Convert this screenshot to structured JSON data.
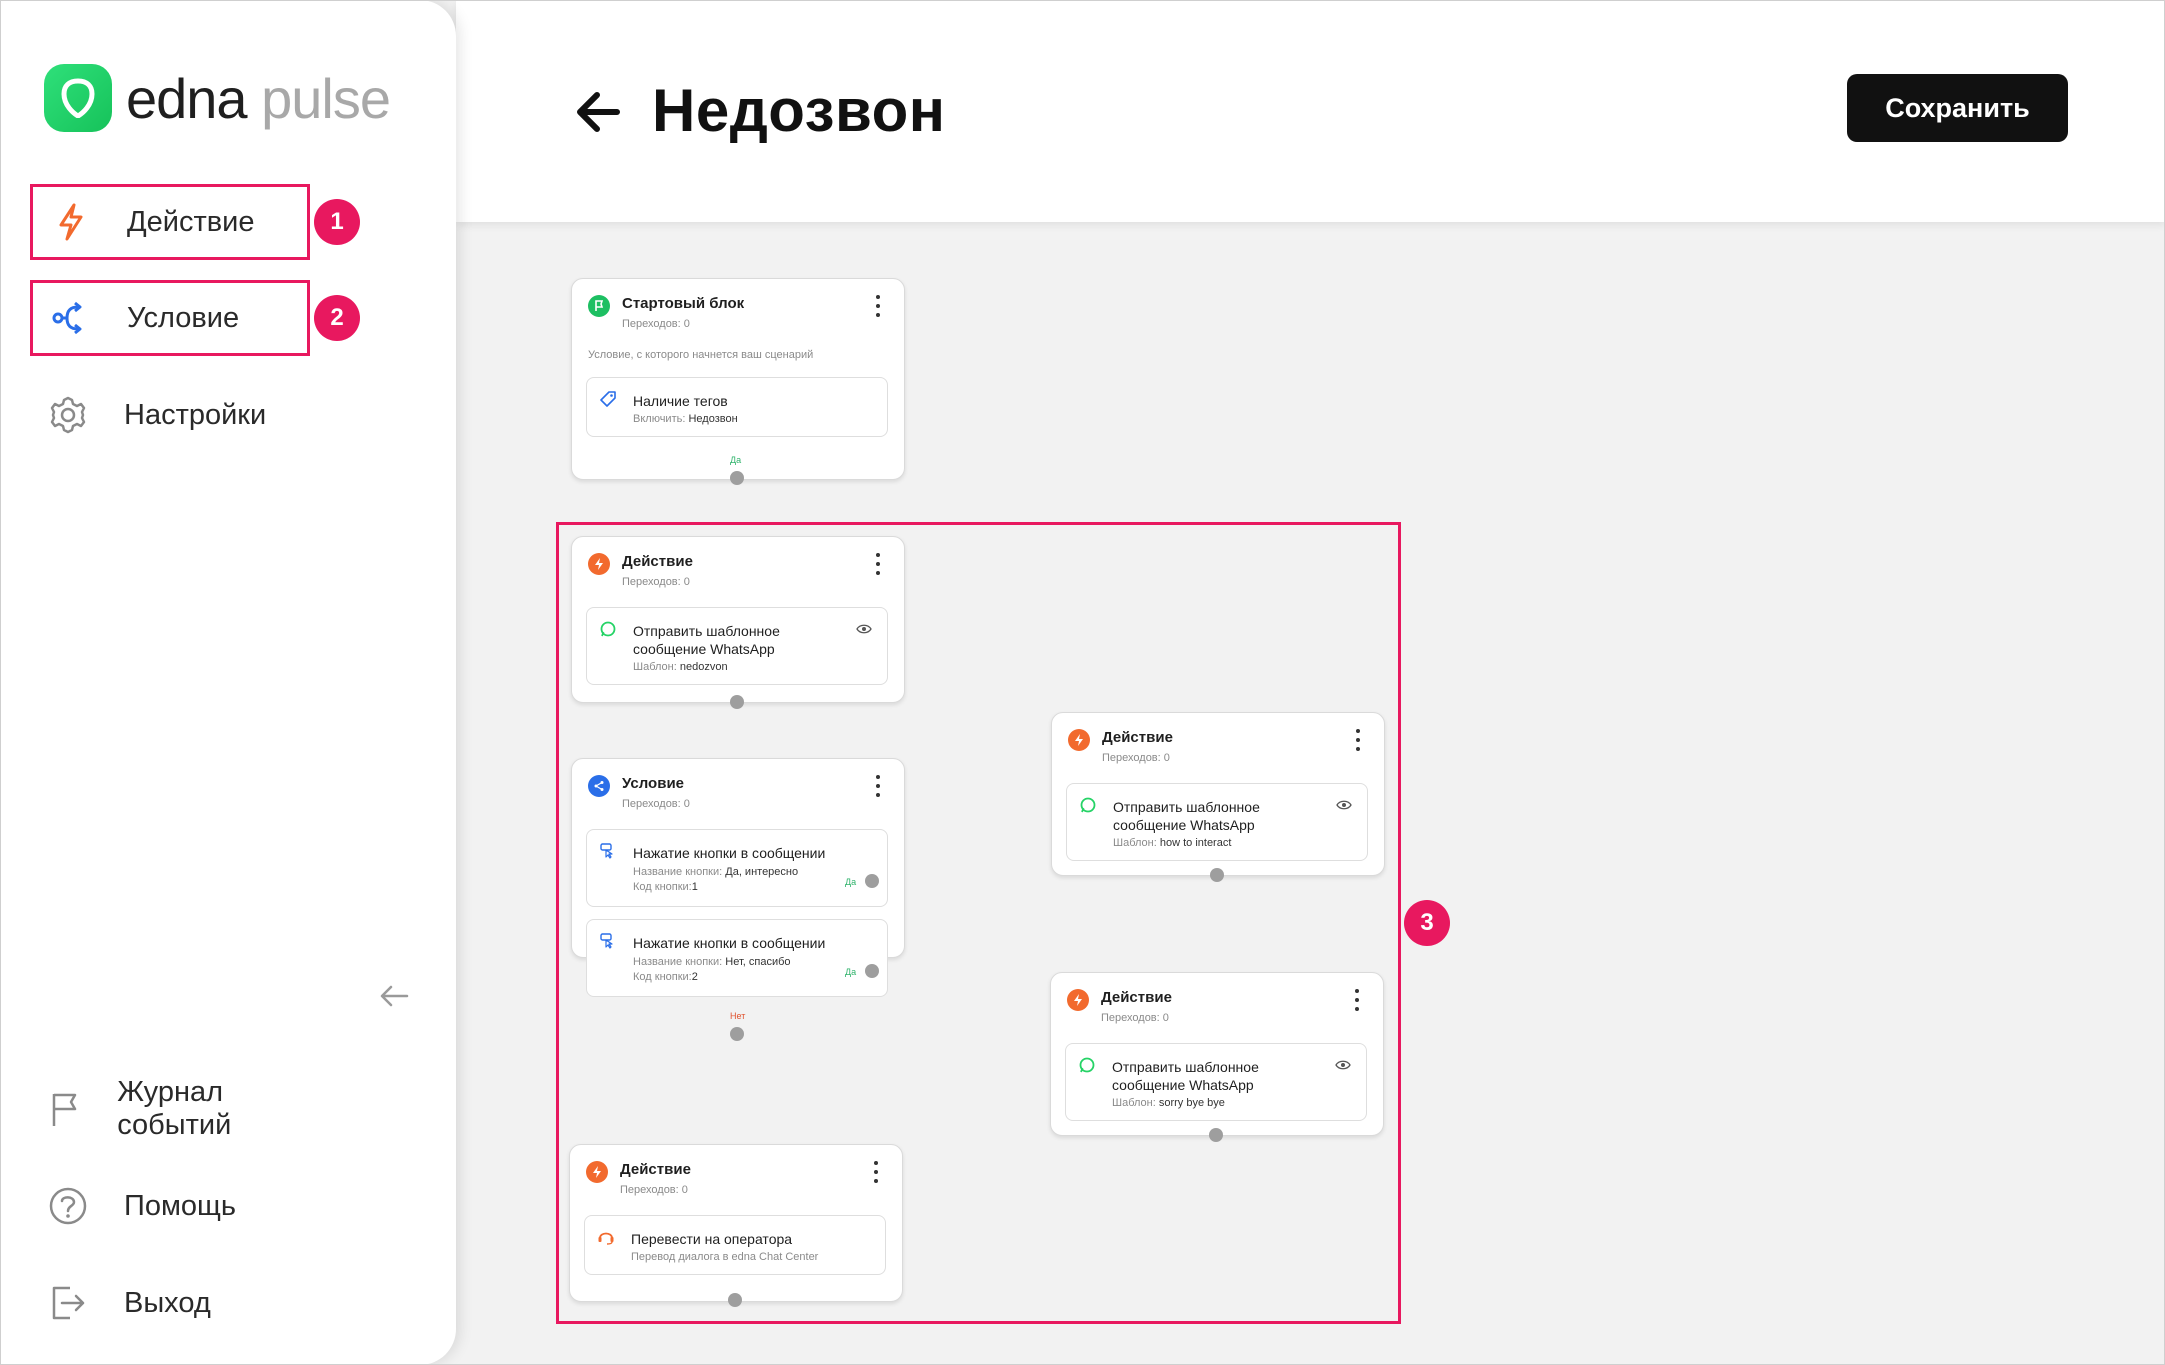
{
  "brand": {
    "name_part1": "edna",
    "name_part2": "pulse"
  },
  "sidebar": {
    "items": [
      {
        "label": "Действие",
        "badge": "1"
      },
      {
        "label": "Условие",
        "badge": "2"
      },
      {
        "label": "Настройки"
      }
    ],
    "bottom_items": [
      {
        "label": "Журнал событий"
      },
      {
        "label": "Помощь"
      },
      {
        "label": "Выход"
      }
    ]
  },
  "header": {
    "title": "Недозвон",
    "save_label": "Сохранить"
  },
  "canvas": {
    "region_badge": "3",
    "start_block": {
      "title": "Стартовый блок",
      "transitions": "Переходов: 0",
      "description": "Условие, с которого начнется ваш сценарий",
      "condition": {
        "title": "Наличие тегов",
        "sub_label": "Включить:",
        "sub_value": "Недозвон"
      },
      "port_label": "Да"
    },
    "action_1": {
      "title": "Действие",
      "transitions": "Переходов: 0",
      "item": {
        "title_line1": "Отправить шаблонное",
        "title_line2": "сообщение WhatsApp",
        "sub_label": "Шаблон:",
        "sub_value": "nedozvon"
      }
    },
    "condition_block": {
      "title": "Условие",
      "transitions": "Переходов: 0",
      "items": [
        {
          "title": "Нажатие кнопки в сообщении",
          "name_label": "Название кнопки:",
          "name_value": "Да, интересно",
          "code_label": "Код кнопки:",
          "code_value": "1",
          "port_label": "Да"
        },
        {
          "title": "Нажатие кнопки в сообщении",
          "name_label": "Название кнопки:",
          "name_value": "Нет, спасибо",
          "code_label": "Код кнопки:",
          "code_value": "2",
          "port_label": "Да"
        }
      ],
      "port_label": "Нет"
    },
    "action_operator": {
      "title": "Действие",
      "transitions": "Переходов: 0",
      "item": {
        "title": "Перевести на оператора",
        "sub": "Перевод диалога в edna Chat Center"
      }
    },
    "action_2": {
      "title": "Действие",
      "transitions": "Переходов: 0",
      "item": {
        "title_line1": "Отправить шаблонное",
        "title_line2": "сообщение WhatsApp",
        "sub_label": "Шаблон:",
        "sub_value": "how to interact"
      }
    },
    "action_3": {
      "title": "Действие",
      "transitions": "Переходов: 0",
      "item": {
        "title_line1": "Отправить шаблонное",
        "title_line2": "сообщение WhatsApp",
        "sub_label": "Шаблон:",
        "sub_value": "sorry bye bye"
      }
    }
  },
  "colors": {
    "accent": "#e8185f",
    "action_orange": "#f26a2e",
    "condition_blue": "#2a6ee8",
    "start_green": "#1dbf62",
    "whatsapp_green": "#25d366",
    "port_yes": "#2fb36b",
    "port_no": "#e0532f",
    "primary_button": "#111111"
  },
  "icons": {
    "action": "lightning-icon",
    "condition": "branch-icon",
    "settings": "gear-icon",
    "log": "flag-icon",
    "help": "question-icon",
    "logout": "logout-icon",
    "back": "arrow-left-icon",
    "collapse": "arrow-left-icon",
    "eye": "eye-icon",
    "whatsapp": "whatsapp-icon",
    "tag": "tag-icon",
    "button_click": "button-click-icon",
    "operator": "operator-icon",
    "start": "flag-icon"
  }
}
